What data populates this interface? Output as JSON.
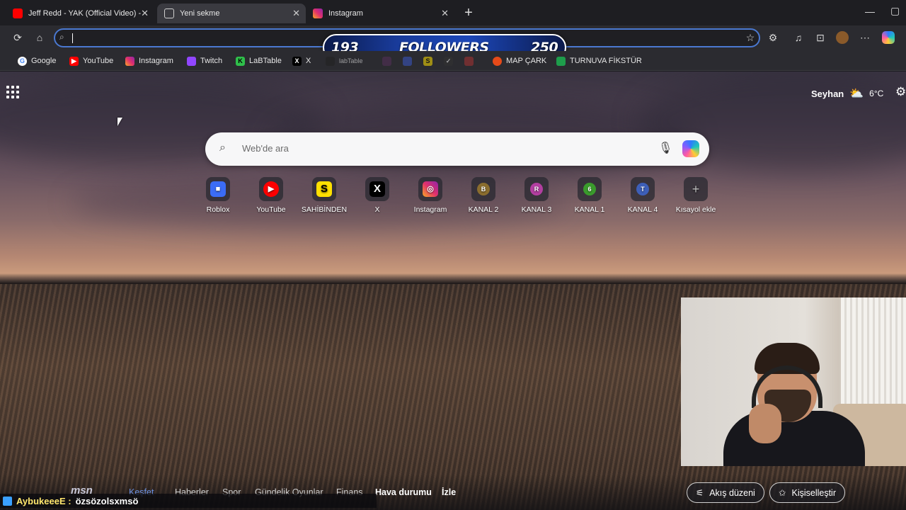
{
  "tabs": [
    {
      "label": "Jeff Redd - YAK (Official Video) - Y",
      "icon": "youtube-icon",
      "color": "#ff0000"
    },
    {
      "label": "Yeni sekme",
      "icon": "newtab-icon",
      "color": "#cfcfcf"
    },
    {
      "label": "Instagram",
      "icon": "instagram-icon",
      "color": "#e1306c"
    }
  ],
  "followers": {
    "current": "193",
    "label": "FOLLOWERS",
    "goal": "250"
  },
  "bookmarks": [
    {
      "label": "Google",
      "icon": "google-icon",
      "color": "#4285f4"
    },
    {
      "label": "YouTube",
      "icon": "youtube-icon",
      "color": "#ff0000"
    },
    {
      "label": "Instagram",
      "icon": "instagram-icon",
      "color": "#e1306c"
    },
    {
      "label": "Twitch",
      "icon": "twitch-icon",
      "color": "#9146ff"
    },
    {
      "label": "LaBTable",
      "icon": "labtable-icon",
      "color": "#2fbf4a"
    },
    {
      "label": "X",
      "icon": "x-icon",
      "color": "#000000"
    },
    {
      "label": "labTable",
      "icon": "labtable-icon",
      "color": "#222222"
    },
    {
      "label": "MAP ÇARK",
      "icon": "wheel-icon",
      "color": "#e64a19"
    },
    {
      "label": "TURNUVA FİKSTÜR",
      "icon": "sheets-icon",
      "color": "#1e9d4b"
    }
  ],
  "weather": {
    "location": "Seyhan",
    "temp": "6°C"
  },
  "search": {
    "placeholder": "Web'de ara"
  },
  "shortcuts": [
    {
      "label": "Roblox",
      "glyph": "■",
      "color": "#3b6cf5"
    },
    {
      "label": "YouTube",
      "glyph": "▶",
      "color": "#ff0000"
    },
    {
      "label": "SAHİBİNDEN",
      "glyph": "S",
      "color": "#ffe000"
    },
    {
      "label": "X",
      "glyph": "X",
      "color": "#000000"
    },
    {
      "label": "Instagram",
      "glyph": "◎",
      "color": "#e1306c"
    },
    {
      "label": "KANAL 2",
      "glyph": "B",
      "color": "#8a6d2e"
    },
    {
      "label": "KANAL 3",
      "glyph": "R",
      "color": "#b23fa0"
    },
    {
      "label": "KANAL 1",
      "glyph": "6",
      "color": "#3a9b2c"
    },
    {
      "label": "KANAL 4",
      "glyph": "T",
      "color": "#3d5fb8"
    },
    {
      "label": "Kısayol ekle",
      "glyph": "+",
      "color": "#5a5a62"
    }
  ],
  "feed_nav": {
    "brand": "msn",
    "items": [
      "Keşfet",
      "Haberler",
      "Spor",
      "Gündelik Oyunlar",
      "Finans",
      "Hava durumu",
      "İzle"
    ]
  },
  "actions": {
    "feed_layout": "Akış düzeni",
    "personalize": "Kişiselleştir"
  },
  "chat": {
    "user": "AybukeeeE :",
    "message": "özsözolsxmsö"
  }
}
